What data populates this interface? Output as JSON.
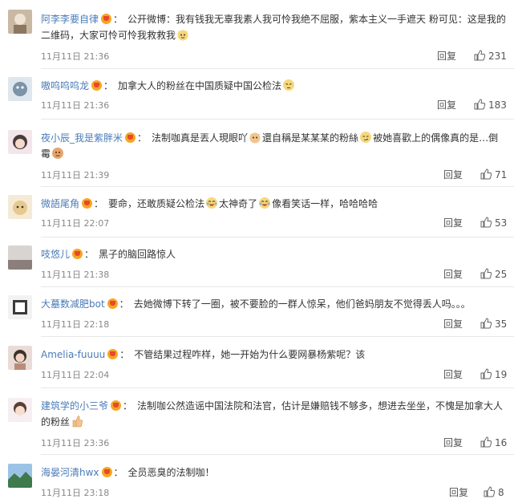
{
  "comments": [
    {
      "username": "阿李李要自律",
      "segments": [
        "公开微博：我有钱我无辜我素人我可怜我绝不屈服，紫本主义一手遮天 粉可见：这是我的二维码，大家可怜可怜我救救我"
      ],
      "emojis": [
        "cat-face-emoji"
      ],
      "time": "11月11日 21:36",
      "reply": "回复",
      "likes": "231"
    },
    {
      "username": "嗷呜呜呜龙",
      "segments": [
        "加拿大人的粉丝在中国质疑中国公检法"
      ],
      "emojis": [
        "pensive-face-emoji"
      ],
      "time": "11月11日 21:36",
      "reply": "回复",
      "likes": "183"
    },
    {
      "username": "夜小辰_我是紫胖米",
      "segments": [
        "法制咖真是丟人現眼吖",
        "還自稱是某某某的粉絲",
        "被她喜歡上的偶像真的是…倒霉"
      ],
      "emojis": [
        "cat-face-emoji",
        "smirk-face-emoji",
        "awkward-face-emoji"
      ],
      "time": "11月11日 21:39",
      "reply": "回复",
      "likes": "71"
    },
    {
      "username": "微語尾角",
      "segments": [
        "要命，还敢质疑公检法",
        "太神奇了",
        "像看笑话一样，哈哈哈哈"
      ],
      "emojis": [
        "laugh-cry-emoji",
        "laugh-cry-emoji"
      ],
      "time": "11月11日 22:07",
      "reply": "回复",
      "likes": "53"
    },
    {
      "username": "吱悠儿",
      "segments": [
        "黑子的脑回路惊人"
      ],
      "emojis": [],
      "time": "11月11日 21:38",
      "reply": "回复",
      "likes": "25"
    },
    {
      "username": "大墓数减肥bot",
      "segments": [
        "去她微博下转了一圈，被不要脸的一群人惊呆，他们爸妈朋友不觉得丢人吗。。。"
      ],
      "emojis": [],
      "time": "11月11日 22:18",
      "reply": "回复",
      "likes": "35"
    },
    {
      "username": "Amelia-fuuuu",
      "segments": [
        "不管结果过程咋样，她一开始为什么要网暴杨紫呢？该"
      ],
      "emojis": [],
      "time": "11月11日 22:04",
      "reply": "回复",
      "likes": "19"
    },
    {
      "username": "建筑学的小三爷",
      "segments": [
        "法制咖公然造谣中国法院和法官，估计是嫌赔钱不够多，想进去坐坐，不愧是加拿大人的粉丝"
      ],
      "emojis": [
        "thumbs-up-emoji"
      ],
      "time": "11月11日 23:36",
      "reply": "回复",
      "likes": "16"
    },
    {
      "username": "海晏河清hwx",
      "segments": [
        "全员恶臭的法制咖！"
      ],
      "emojis": [],
      "time": "11月11日 23:18",
      "reply": "回复",
      "likes": "8"
    }
  ],
  "colors": {
    "username": "#4a7bb7",
    "text": "#333333",
    "meta": "#888888",
    "vip_badge": "#f6a623",
    "divider": "#e8e8e8"
  }
}
